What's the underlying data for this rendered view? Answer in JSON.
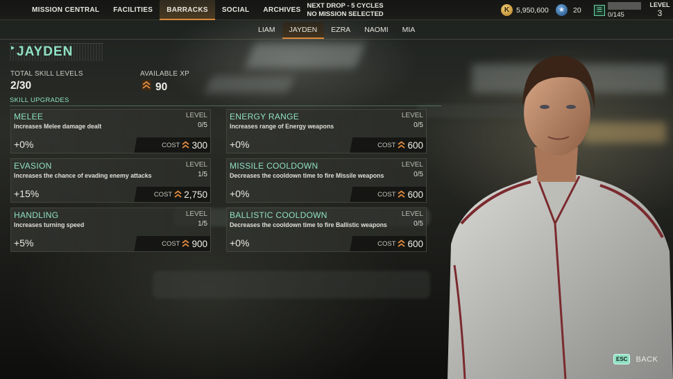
{
  "nav": {
    "items": [
      {
        "label": "MISSION CENTRAL"
      },
      {
        "label": "FACILITIES"
      },
      {
        "label": "BARRACKS",
        "active": true
      },
      {
        "label": "SOCIAL"
      },
      {
        "label": "ARCHIVES"
      }
    ],
    "next_drop": "NEXT DROP - 5 CYCLES",
    "mission_status": "NO MISSION SELECTED"
  },
  "resources": {
    "credits_icon": "K",
    "credits": "5,950,600",
    "stars": "20",
    "pilots": "0/145",
    "level_label": "LEVEL",
    "level": "3"
  },
  "pilot_tabs": [
    {
      "label": "LIAM"
    },
    {
      "label": "JAYDEN",
      "active": true
    },
    {
      "label": "EZRA"
    },
    {
      "label": "NAOMI"
    },
    {
      "label": "MIA"
    }
  ],
  "pilot": {
    "name": "JAYDEN",
    "total_skill_label": "TOTAL SKILL LEVELS",
    "total_skill_value": "2/30",
    "xp_label": "AVAILABLE XP",
    "xp_value": "90"
  },
  "section_title": "SKILL UPGRADES",
  "skill_level_label": "LEVEL",
  "cost_label": "COST",
  "skills": [
    {
      "title": "MELEE",
      "desc": "Increases Melee damage dealt",
      "level": "0/5",
      "bonus": "+0%",
      "cost": "300"
    },
    {
      "title": "ENERGY RANGE",
      "desc": "Increases range of Energy weapons",
      "level": "0/5",
      "bonus": "+0%",
      "cost": "600"
    },
    {
      "title": "EVASION",
      "desc": "Increases the chance of evading enemy attacks",
      "level": "1/5",
      "bonus": "+15%",
      "cost": "2,750"
    },
    {
      "title": "MISSILE COOLDOWN",
      "desc": "Decreases the cooldown time to fire Missile weapons",
      "level": "0/5",
      "bonus": "+0%",
      "cost": "600"
    },
    {
      "title": "HANDLING",
      "desc": "Increases turning speed",
      "level": "1/5",
      "bonus": "+5%",
      "cost": "900"
    },
    {
      "title": "BALLISTIC COOLDOWN",
      "desc": "Decreases the cooldown time to fire Ballistic weapons",
      "level": "0/5",
      "bonus": "+0%",
      "cost": "600"
    }
  ],
  "back": {
    "key": "ESC",
    "label": "BACK"
  },
  "colors": {
    "accent_teal": "#8fe0c4",
    "accent_orange": "#d88a3a",
    "xp_orange": "#e08a3c"
  }
}
